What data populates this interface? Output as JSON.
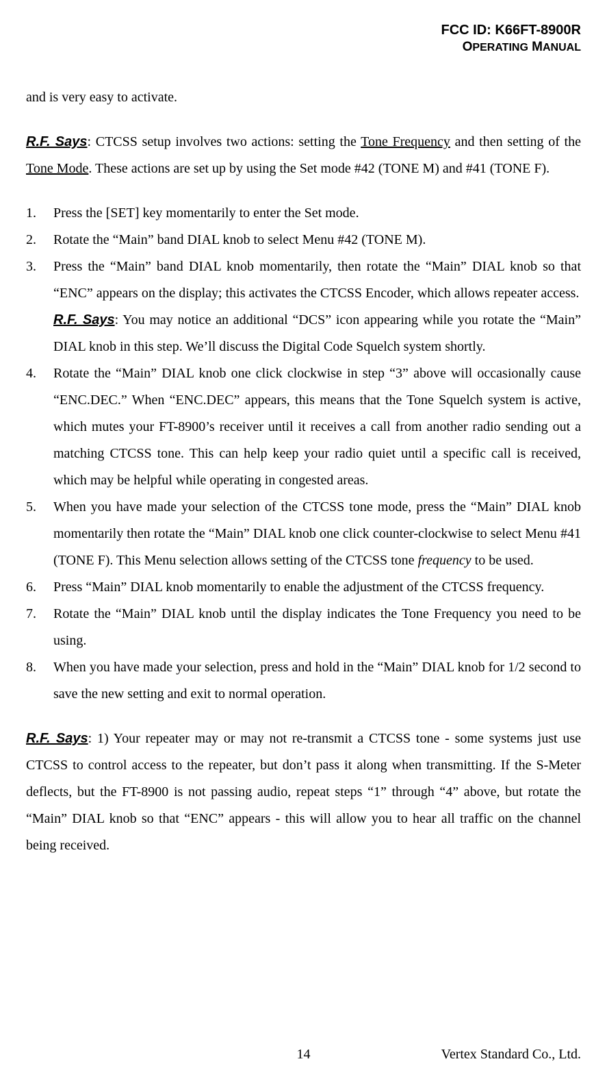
{
  "header": {
    "fcc_id": "FCC ID: K66FT-8900R",
    "operating": "O",
    "perating": "PERATING",
    "manual_m": " M",
    "anual": "ANUAL"
  },
  "intro_continuation": "and is very easy to activate.",
  "rf1": {
    "label": "R.F. Says",
    "before_freq": ": CTCSS setup involves two actions: setting the ",
    "tone_frequency": "Tone Frequency",
    "between": " and then setting of the ",
    "tone_mode": "Tone Mode",
    "after": ". These actions are set up by using the Set mode #42 (TONE M) and #41 (TONE F)."
  },
  "steps": {
    "s1": {
      "n": "1.",
      "t": "Press the [SET] key momentarily to enter the Set mode."
    },
    "s2": {
      "n": "2.",
      "t": "Rotate the “Main” band DIAL knob to select Menu #42 (TONE M)."
    },
    "s3": {
      "n": "3.",
      "t": "Press the “Main” band DIAL knob momentarily, then rotate the “Main” DIAL knob so that “ENC” appears on the display; this activates the CTCSS Encoder, which allows repeater access.",
      "rf_label": "R.F. Says",
      "rf_text": ": You may notice an additional “DCS” icon appearing while you rotate the “Main” DIAL knob in this step. We’ll discuss the Digital Code Squelch system shortly."
    },
    "s4": {
      "n": "4.",
      "t": "Rotate the “Main” DIAL knob one click clockwise in step “3” above will occasionally cause “ENC.DEC.” When “ENC.DEC” appears, this means that the Tone Squelch system is active, which mutes your FT-8900’s receiver until it receives a call from another radio sending out a matching CTCSS tone. This can help keep your radio quiet until a specific call is received, which may be helpful while operating in congested areas."
    },
    "s5": {
      "n": "5.",
      "t1": "When you have made your selection of the CTCSS tone mode, press the “Main” DIAL knob momentarily then rotate the “Main” DIAL knob one click counter-clockwise to select Menu #41 (TONE F). This Menu selection allows setting of the CTCSS tone ",
      "em": "frequency",
      "t2": " to be used."
    },
    "s6": {
      "n": "6.",
      "t": "Press “Main” DIAL knob momentarily to enable the adjustment of the CTCSS frequency."
    },
    "s7": {
      "n": "7.",
      "t": "Rotate the “Main” DIAL knob until the display indicates the Tone Frequency you need to be using."
    },
    "s8": {
      "n": "8.",
      "t": "When you have made your selection, press and hold in the “Main” DIAL knob for 1/2 second to save the new setting and exit to normal operation."
    }
  },
  "rf2": {
    "label": "R.F. Says",
    "text": ": 1) Your repeater may or may not re-transmit a CTCSS tone - some systems just use CTCSS to control access to the repeater, but don’t pass it along when transmitting. If the S-Meter deflects, but the FT-8900 is not passing audio, repeat steps “1” through “4” above, but rotate the “Main” DIAL knob so that “ENC” appears - this will allow you to hear all traffic on the channel being received."
  },
  "footer": {
    "page": "14",
    "company": "Vertex Standard Co., Ltd."
  }
}
